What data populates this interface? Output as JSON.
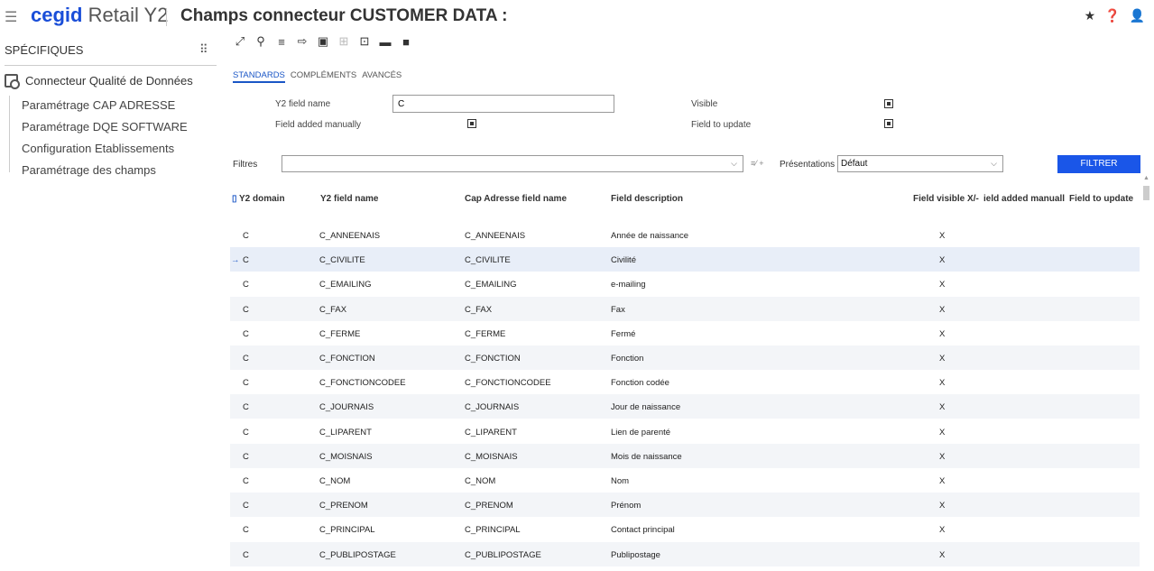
{
  "header": {
    "brand_primary": "cegid",
    "brand_secondary": "Retail Y2",
    "title": "Champs connecteur CUSTOMER DATA :"
  },
  "sidebar": {
    "heading": "SPÉCIFIQUES",
    "main_item": "Connecteur Qualité de Données",
    "items": [
      {
        "label": "Paramétrage CAP ADRESSE"
      },
      {
        "label": "Paramétrage DQE SOFTWARE"
      },
      {
        "label": "Configuration Etablissements"
      },
      {
        "label": "Paramétrage des champs"
      }
    ]
  },
  "tabs": [
    {
      "label": "STANDARDS",
      "active": true
    },
    {
      "label": "COMPLÉMENTS",
      "active": false
    },
    {
      "label": "AVANCÉS",
      "active": false
    }
  ],
  "form": {
    "y2_field_name_label": "Y2 field name",
    "y2_field_name_value": "C",
    "field_added_manually_label": "Field added manually",
    "visible_label": "Visible",
    "field_to_update_label": "Field to update"
  },
  "filters": {
    "filtres_label": "Filtres",
    "presentations_label": "Présentations",
    "presentations_value": "Défaut",
    "filtrer_button": "FILTRER"
  },
  "grid": {
    "columns": {
      "y2_domain": "Y2 domain",
      "y2_field_name": "Y2 field name",
      "cap_field_name": "Cap Adresse field name",
      "field_description": "Field description",
      "field_visible": "Field visible X/-",
      "field_added_manually": "ield added manuall",
      "field_to_update": "Field to update"
    },
    "rows": [
      {
        "domain": "C",
        "name": "C_ANNEENAIS",
        "cap": "C_ANNEENAIS",
        "desc": "Année de naissance",
        "visible": "X"
      },
      {
        "domain": "C",
        "name": "C_CIVILITE",
        "cap": "C_CIVILITE",
        "desc": "Civilité",
        "visible": "X"
      },
      {
        "domain": "C",
        "name": "C_EMAILING",
        "cap": "C_EMAILING",
        "desc": "e-mailing",
        "visible": "X"
      },
      {
        "domain": "C",
        "name": "C_FAX",
        "cap": "C_FAX",
        "desc": "Fax",
        "visible": "X"
      },
      {
        "domain": "C",
        "name": "C_FERME",
        "cap": "C_FERME",
        "desc": "Fermé",
        "visible": "X"
      },
      {
        "domain": "C",
        "name": "C_FONCTION",
        "cap": "C_FONCTION",
        "desc": "Fonction",
        "visible": "X"
      },
      {
        "domain": "C",
        "name": "C_FONCTIONCODEE",
        "cap": "C_FONCTIONCODEE",
        "desc": "Fonction codée",
        "visible": "X"
      },
      {
        "domain": "C",
        "name": "C_JOURNAIS",
        "cap": "C_JOURNAIS",
        "desc": "Jour de naissance",
        "visible": "X"
      },
      {
        "domain": "C",
        "name": "C_LIPARENT",
        "cap": "C_LIPARENT",
        "desc": "Lien de parenté",
        "visible": "X"
      },
      {
        "domain": "C",
        "name": "C_MOISNAIS",
        "cap": "C_MOISNAIS",
        "desc": "Mois de naissance",
        "visible": "X"
      },
      {
        "domain": "C",
        "name": "C_NOM",
        "cap": "C_NOM",
        "desc": "Nom",
        "visible": "X"
      },
      {
        "domain": "C",
        "name": "C_PRENOM",
        "cap": "C_PRENOM",
        "desc": "Prénom",
        "visible": "X"
      },
      {
        "domain": "C",
        "name": "C_PRINCIPAL",
        "cap": "C_PRINCIPAL",
        "desc": "Contact principal",
        "visible": "X"
      },
      {
        "domain": "C",
        "name": "C_PUBLIPOSTAGE",
        "cap": "C_PUBLIPOSTAGE",
        "desc": "Publipostage",
        "visible": "X"
      }
    ],
    "selected_index": 1
  }
}
